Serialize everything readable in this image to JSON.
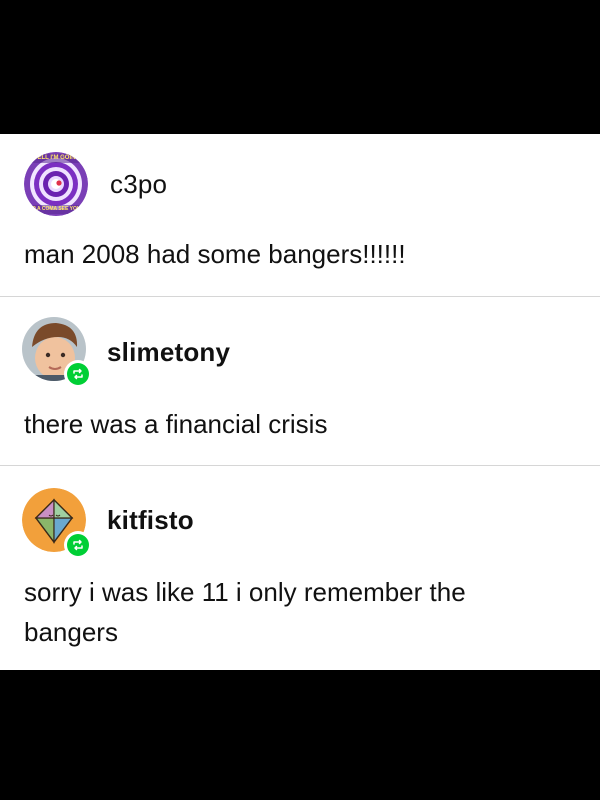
{
  "posts": [
    {
      "username": "c3po",
      "avatar_icon": "hypnotic-spiral-avatar-icon",
      "avatar_text_top": "WELL I'M GOING",
      "avatar_text_bottom": "INTO A COMA SEE YOU LATER",
      "body": "man 2008 had some bangers!!!!!!"
    },
    {
      "username": "slimetony",
      "avatar_icon": "child-photo-avatar-icon",
      "badge_icon": "reblog-icon",
      "body": "there was a financial crisis"
    },
    {
      "username": "kitfisto",
      "avatar_icon": "diamond-gem-avatar-icon",
      "badge_icon": "reblog-icon",
      "body_line1": "sorry i was like 11 i only remember the",
      "body_line2": "bangers"
    }
  ],
  "colors": {
    "background": "#000000",
    "panel": "#ffffff",
    "text": "#111111",
    "divider": "#d6d6d6",
    "reblog_badge": "#00cf35"
  }
}
